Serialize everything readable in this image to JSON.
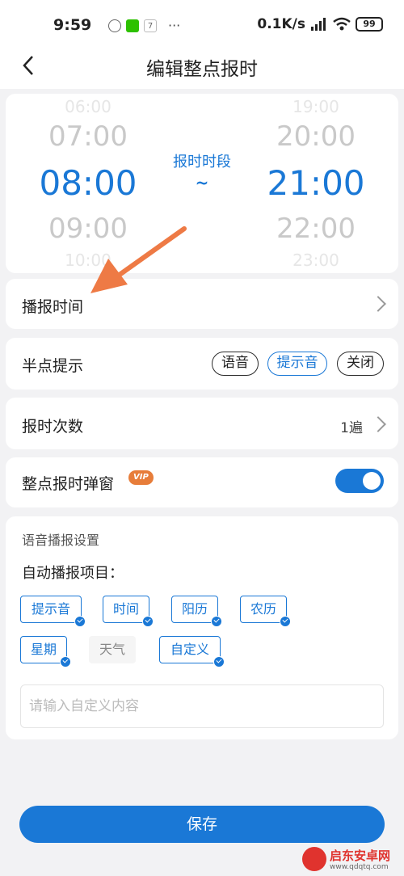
{
  "status_bar": {
    "time": "9:59",
    "calendar_day": "7",
    "more": "···",
    "network_speed": "0.1K/s",
    "battery": "99"
  },
  "nav": {
    "title": "编辑整点报时"
  },
  "time_picker": {
    "start": {
      "far_above": "06:00",
      "above": "07:00",
      "selected": "08:00",
      "below": "09:00",
      "far_below": "10:00"
    },
    "end": {
      "far_above": "19:00",
      "above": "20:00",
      "selected": "21:00",
      "below": "22:00",
      "far_below": "23:00"
    },
    "label": "报时时段",
    "separator": "~"
  },
  "broadcast_time": {
    "label": "播报时间"
  },
  "half_hour": {
    "label": "半点提示",
    "options": [
      "语音",
      "提示音",
      "关闭"
    ],
    "selected": "提示音"
  },
  "repeat_count": {
    "label": "报时次数",
    "value": "1遍"
  },
  "popup": {
    "label": "整点报时弹窗",
    "badge": "VIP",
    "enabled": true
  },
  "voice_settings": {
    "section_title": "语音播报设置",
    "subtitle": "自动播报项目：",
    "items": [
      {
        "label": "提示音",
        "checked": true
      },
      {
        "label": "时间",
        "checked": true
      },
      {
        "label": "阳历",
        "checked": true
      },
      {
        "label": "农历",
        "checked": true
      },
      {
        "label": "星期",
        "checked": true
      },
      {
        "label": "天气",
        "checked": false
      },
      {
        "label": "自定义",
        "checked": true
      }
    ],
    "custom_input_placeholder": "请输入自定义内容"
  },
  "save_label": "保存",
  "watermark": {
    "title": "启东安卓网",
    "url": "www.qdqtq.com"
  },
  "colors": {
    "accent": "#1a78d6",
    "annotation_arrow": "#ee7a45",
    "vip": "#e77d3a"
  }
}
